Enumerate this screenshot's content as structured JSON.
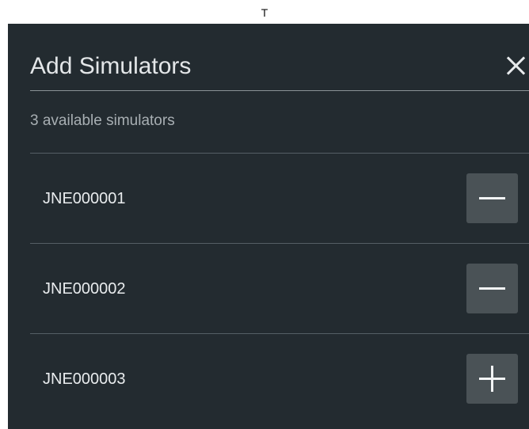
{
  "top_text": "T",
  "dialog": {
    "title": "Add Simulators",
    "close_icon": "close-icon",
    "count_text": "3 available simulators"
  },
  "simulators": [
    {
      "name": "JNE000001",
      "action": "remove",
      "icon": "minus-icon"
    },
    {
      "name": "JNE000002",
      "action": "remove",
      "icon": "minus-icon"
    },
    {
      "name": "JNE000003",
      "action": "add",
      "icon": "plus-icon"
    }
  ],
  "colors": {
    "panel_background": "#232b30",
    "button_background": "#4a5256",
    "text_primary": "#e3e6e8",
    "text_secondary": "#a8afb3"
  }
}
